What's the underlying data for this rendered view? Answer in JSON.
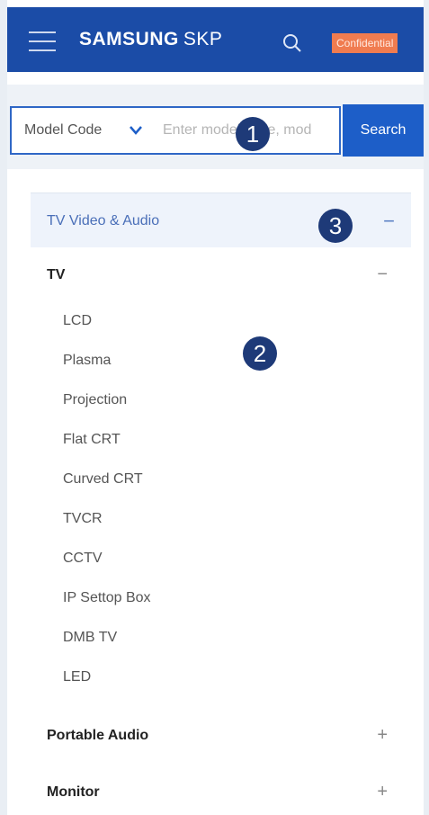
{
  "header": {
    "brand_bold": "SAMSUNG",
    "brand_light": "SKP",
    "badge": "Confidential",
    "icons": [
      "hamburger-menu-icon",
      "search-icon"
    ]
  },
  "search": {
    "select_label": "Model Code",
    "placeholder": "Enter model code, mod",
    "button_label": "Search"
  },
  "category": {
    "label": "TV Video & Audio",
    "toggle": "−"
  },
  "groups": [
    {
      "label": "TV",
      "toggle": "−",
      "items": [
        "LCD",
        "Plasma",
        "Projection",
        "Flat CRT",
        "Curved CRT",
        "TVCR",
        "CCTV",
        "IP Settop Box",
        "DMB TV",
        "LED"
      ]
    },
    {
      "label": "Portable Audio",
      "toggle": "+"
    },
    {
      "label": "Monitor",
      "toggle": "+"
    }
  ],
  "callouts": [
    "1",
    "2",
    "3"
  ],
  "colors": {
    "header_bg": "#1b4ca7",
    "search_button": "#1d5ec8",
    "badge": "#f07c50",
    "callout": "#1e3a78"
  }
}
